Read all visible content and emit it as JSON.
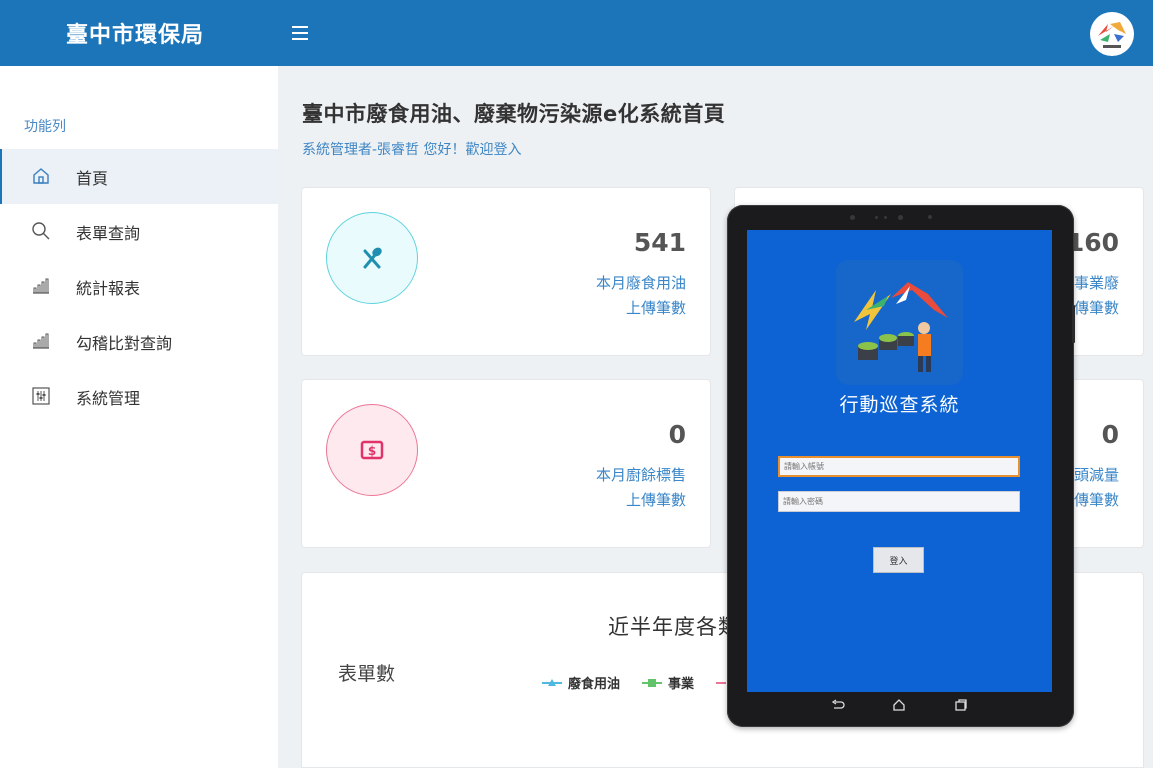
{
  "header": {
    "brand": "臺中市環保局",
    "menu_icon": "hamburger-icon",
    "avatar_icon": "city-logo-icon"
  },
  "sidebar": {
    "title": "功能列",
    "items": [
      {
        "label": "首頁",
        "icon": "home-icon",
        "active": true
      },
      {
        "label": "表單查詢",
        "icon": "search-icon",
        "active": false
      },
      {
        "label": "統計報表",
        "icon": "bar-chart-icon",
        "active": false
      },
      {
        "label": "勾稽比對查詢",
        "icon": "bar-chart-icon",
        "active": false
      },
      {
        "label": "系統管理",
        "icon": "sliders-icon",
        "active": false
      }
    ]
  },
  "main": {
    "title": "臺中市廢食用油、廢棄物污染源e化系統首頁",
    "welcome": "系統管理者-張睿哲 您好！歡迎登入",
    "cards": [
      {
        "value": "541",
        "label_line1": "本月廢食用油",
        "label_line2": "上傳筆數",
        "icon": "utensils-icon",
        "color": "#5fd3dc"
      },
      {
        "value": "160",
        "label_line1": "事業廢",
        "label_line2": "傳筆數"
      },
      {
        "value": "0",
        "label_line1": "本月廚餘標售",
        "label_line2": "上傳筆數",
        "icon": "money-icon",
        "color": "#ec7595"
      },
      {
        "value": "0",
        "label_line1": "頭減量",
        "label_line2": "傳筆數"
      }
    ],
    "chart": {
      "title": "近半年度各類",
      "ylabel": "表單數",
      "legend": [
        {
          "name": "廢食用油",
          "color": "#4fb8e0"
        },
        {
          "name": "事業",
          "color": "#62c36a"
        }
      ]
    }
  },
  "tablet": {
    "app_title": "行動巡查系統",
    "account_placeholder": "請輸入帳號",
    "password_placeholder": "請輸入密碼",
    "login_label": "登入",
    "softkeys": [
      "back-icon",
      "home-icon",
      "recent-apps-icon"
    ]
  }
}
